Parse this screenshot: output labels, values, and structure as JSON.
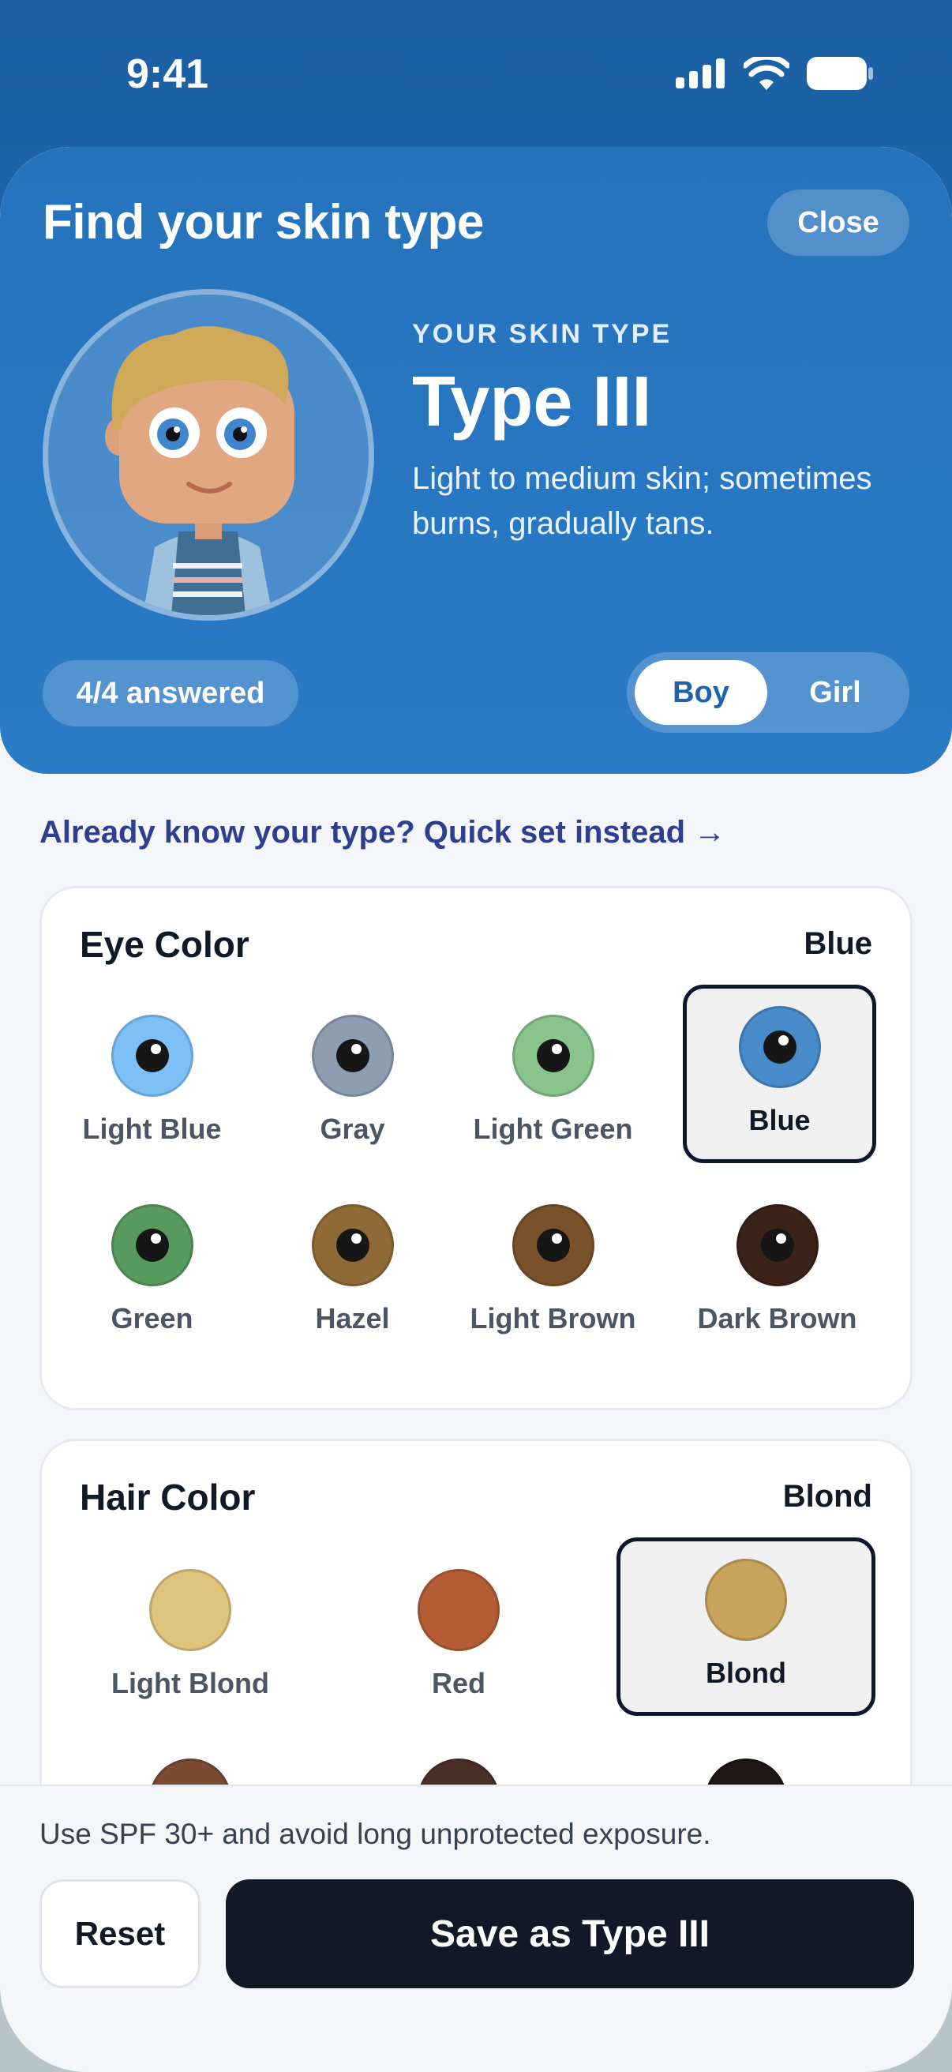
{
  "status": {
    "time": "9:41"
  },
  "header": {
    "title": "Find your skin type",
    "close_label": "Close",
    "kicker": "YOUR SKIN TYPE",
    "type_name": "Type III",
    "type_desc": "Light to medium skin; sometimes burns, gradually tans.",
    "answered": "4/4 answered",
    "toggle": {
      "boy": "Boy",
      "girl": "Girl",
      "selected": "Boy"
    }
  },
  "quick_link": "Already know your type? Quick set instead →",
  "eye": {
    "title": "Eye Color",
    "value": "Blue",
    "options": [
      {
        "label": "Light Blue",
        "color": "#7dbff7"
      },
      {
        "label": "Gray",
        "color": "#8f9db1"
      },
      {
        "label": "Light Green",
        "color": "#88c48c"
      },
      {
        "label": "Blue",
        "color": "#478bca",
        "selected": true
      },
      {
        "label": "Green",
        "color": "#589a5d"
      },
      {
        "label": "Hazel",
        "color": "#8f6a36"
      },
      {
        "label": "Light Brown",
        "color": "#7a522a"
      },
      {
        "label": "Dark Brown",
        "color": "#3b2318"
      }
    ]
  },
  "hair": {
    "title": "Hair Color",
    "value": "Blond",
    "options": [
      {
        "label": "Light Blond",
        "color": "#dfc47e"
      },
      {
        "label": "Red",
        "color": "#b45d35"
      },
      {
        "label": "Blond",
        "color": "#c9a35c",
        "selected": true
      },
      {
        "label": "",
        "color": "#7a4b32"
      },
      {
        "label": "",
        "color": "#4a3024"
      },
      {
        "label": "",
        "color": "#1d1715"
      }
    ]
  },
  "footer": {
    "tip": "Use SPF 30+ and avoid long unprotected exposure.",
    "reset_label": "Reset",
    "save_label": "Save as Type III"
  }
}
